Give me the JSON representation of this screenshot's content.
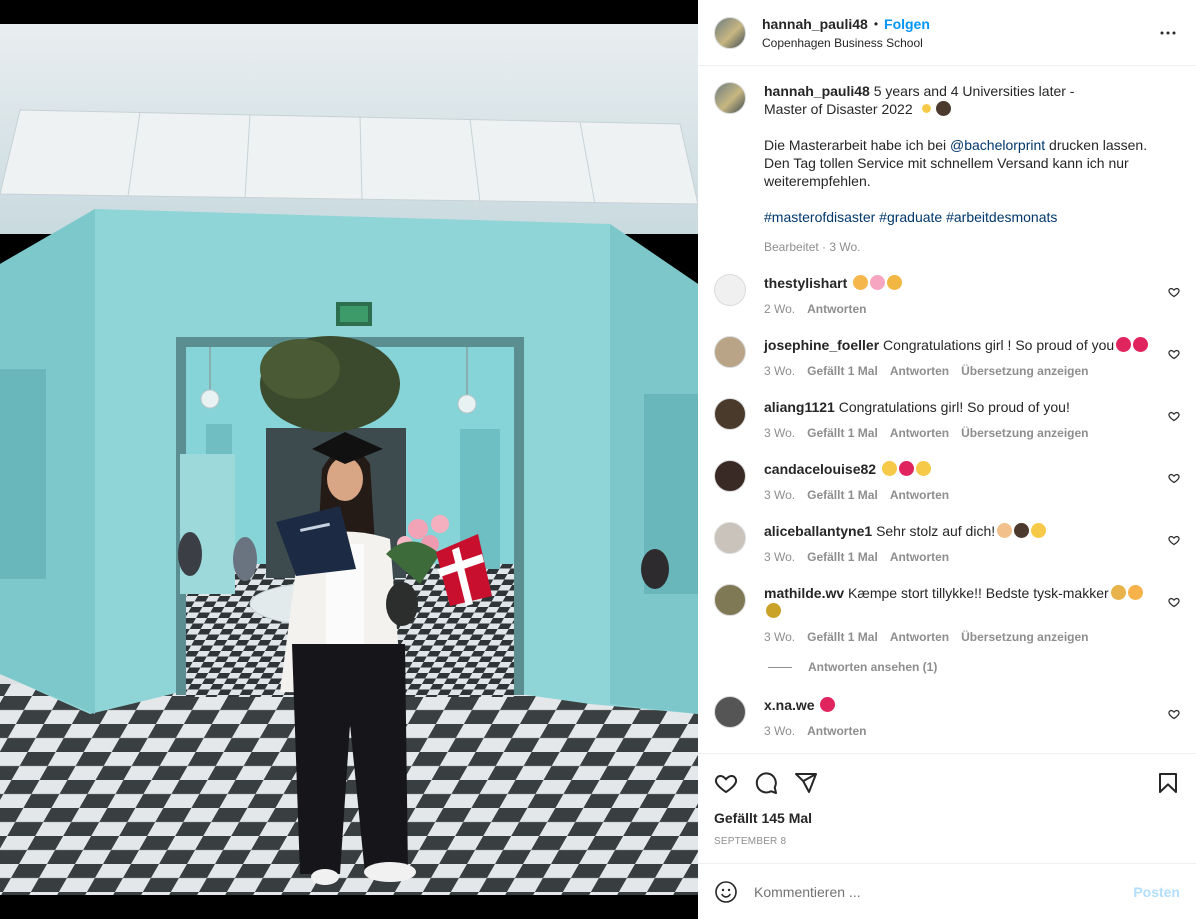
{
  "post": {
    "username": "hannah_pauli48",
    "follow_label": "Folgen",
    "separator": "•",
    "location": "Copenhagen Business School",
    "caption_line1": "5 years and 4 Universities later -",
    "caption_line2": "Master of Disaster 2022",
    "caption_p2_a": "Die Masterarbeit habe ich bei",
    "caption_mention": "@bachelorprint",
    "caption_p2_b": "drucken lassen. Den Tag tollen Service mit schnellem Versand kann ich nur weiterempfehlen.",
    "hashtags": "#masterofdisaster #graduate #arbeitdesmonats",
    "edited_label": "Bearbeitet · 3 Wo.",
    "likes": "Gefällt 145 Mal",
    "date": "SEPTEMBER 8"
  },
  "comments": [
    {
      "user": "thestylishart",
      "text": "",
      "emoji": [
        "👍",
        "🌸",
        "🎉"
      ],
      "time": "2 Wo.",
      "likes": "",
      "reply": "Antworten",
      "translate": "",
      "avatar_color": "#f0f0f0"
    },
    {
      "user": "josephine_foeller",
      "text": "Congratulations girl ! So proud of you",
      "emoji": [
        "❤️",
        "❤️"
      ],
      "time": "3 Wo.",
      "likes": "Gefällt 1 Mal",
      "reply": "Antworten",
      "translate": "Übersetzung anzeigen",
      "avatar_color": "#b9a487"
    },
    {
      "user": "aliang1121",
      "text": "Congratulations girl! So proud of you!",
      "emoji": [],
      "time": "3 Wo.",
      "likes": "Gefällt 1 Mal",
      "reply": "Antworten",
      "translate": "Übersetzung anzeigen",
      "avatar_color": "#4a3a2c"
    },
    {
      "user": "candacelouise82",
      "text": "",
      "emoji": [
        "🥳",
        "❤️",
        "🥳"
      ],
      "time": "3 Wo.",
      "likes": "Gefällt 1 Mal",
      "reply": "Antworten",
      "translate": "",
      "avatar_color": "#3a2a26"
    },
    {
      "user": "aliceballantyne1",
      "text": "Sehr stolz auf dich!",
      "emoji": [
        "🙌",
        "👩‍🎓",
        "🥳"
      ],
      "time": "3 Wo.",
      "likes": "Gefällt 1 Mal",
      "reply": "Antworten",
      "translate": "",
      "avatar_color": "#c9c3bb"
    },
    {
      "user": "mathilde.wv",
      "text": "Kæmpe stort tillykke!! Bedste tysk-makker",
      "emoji": [
        "🍻",
        "🥰",
        "⚜️"
      ],
      "time": "3 Wo.",
      "likes": "Gefällt 1 Mal",
      "reply": "Antworten",
      "translate": "Übersetzung anzeigen",
      "avatar_color": "#7f7a55"
    },
    {
      "user": "x.na.we",
      "text": "",
      "emoji": [
        "❤️"
      ],
      "time": "3 Wo.",
      "likes": "",
      "reply": "Antworten",
      "translate": "",
      "avatar_color": "#555555"
    }
  ],
  "view_replies": "Antworten ansehen (1)",
  "composer": {
    "placeholder": "Kommentieren ...",
    "post_label": "Posten"
  },
  "icons": {
    "like": "heart-icon",
    "comment": "comment-icon",
    "share": "share-icon",
    "save": "bookmark-icon",
    "emoji": "smiley-icon",
    "more": "more-icon"
  },
  "colors": {
    "link": "#0095f6",
    "muted": "#8e8e8e",
    "wall": "#8fd4d6",
    "post_disabled": "#b2dffc"
  }
}
